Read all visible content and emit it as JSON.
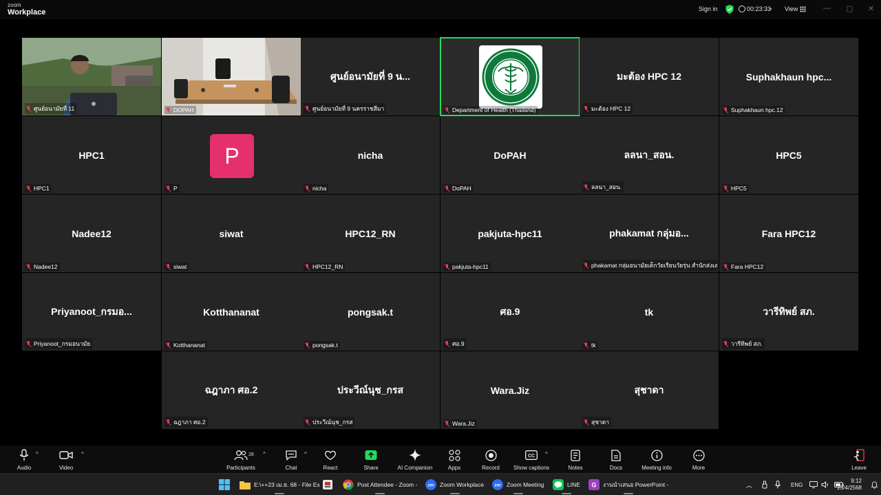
{
  "app": {
    "logo_line1": "zoom",
    "logo_line2": "Workplace",
    "sign_in": "Sign in",
    "timer": "00:23:33",
    "view": "View"
  },
  "tiles": [
    {
      "type": "video",
      "scene": "person",
      "label": "ศูนย์อนามัยที่ 11"
    },
    {
      "type": "video",
      "scene": "room",
      "label": "DOPAH"
    },
    {
      "type": "name",
      "display": "ศูนย์อนามัยที่ 9 น...",
      "label": "ศูนย์อนามัยที่ 9 นครราชสีมา"
    },
    {
      "type": "logo",
      "logo_text": "MINISTRY OF PUBLIC HEALTH",
      "label": "Department of Health (Thailand)",
      "active": true
    },
    {
      "type": "name",
      "display": "มะต้อง HPC 12",
      "label": "มะต้อง HPC 12"
    },
    {
      "type": "name",
      "display": "Suphakhaun  hpc...",
      "label": "Suphakhaun hpc.12"
    },
    {
      "type": "name",
      "display": "HPC1",
      "label": "HPC1"
    },
    {
      "type": "avatar",
      "initial": "P",
      "label": "P"
    },
    {
      "type": "name",
      "display": "nicha",
      "label": "nicha"
    },
    {
      "type": "name",
      "display": "DoPAH",
      "label": "DoPAH"
    },
    {
      "type": "name",
      "display": "ลลนา_สอน.",
      "label": "ลลนา_สอน."
    },
    {
      "type": "name",
      "display": "HPC5",
      "label": "HPC5"
    },
    {
      "type": "name",
      "display": "Nadee12",
      "label": "Nadee12"
    },
    {
      "type": "name",
      "display": "siwat",
      "label": "siwat"
    },
    {
      "type": "name",
      "display": "HPC12_RN",
      "label": "HPC12_RN"
    },
    {
      "type": "name",
      "display": "pakjuta-hpc11",
      "label": "pakjuta-hpc11"
    },
    {
      "type": "name",
      "display": "phakamat กลุ่มอ...",
      "label": "phakamat กลุ่มอนามัยเด็กวัยเรียนวัยรุ่น สำนักส่งเสริม..."
    },
    {
      "type": "name",
      "display": "Fara HPC12",
      "label": "Fara HPC12"
    },
    {
      "type": "name",
      "display": "Priyanoot_กรมอ...",
      "label": "Priyanoot_กรมอนามัย"
    },
    {
      "type": "name",
      "display": "Kotthananat",
      "label": "Kotthananat"
    },
    {
      "type": "name",
      "display": "pongsak.t",
      "label": "pongsak.t"
    },
    {
      "type": "name",
      "display": "ศอ.9",
      "label": "ศอ.9"
    },
    {
      "type": "name",
      "display": "tk",
      "label": "tk"
    },
    {
      "type": "name",
      "display": "วารีทิพย์ สภ.",
      "label": "วารีทิพย์ สภ."
    },
    {
      "type": "name",
      "display": "ฉฎาภา ศอ.2",
      "label": "ฉฎาภา ศอ.2"
    },
    {
      "type": "name",
      "display": "ประวีณ์นุช_กรส",
      "label": "ประวีณ์นุช_กรส"
    },
    {
      "type": "name",
      "display": "Wara.Jiz",
      "label": "Wara.Jiz"
    },
    {
      "type": "name",
      "display": "สุชาดา",
      "label": "สุชาดา"
    }
  ],
  "toolbar": {
    "audio": "Audio",
    "video": "Video",
    "participants": "Participants",
    "participants_count": "28",
    "chat": "Chat",
    "react": "React",
    "share": "Share",
    "ai_companion": "AI Companion",
    "apps": "Apps",
    "record": "Record",
    "captions": "Show captions",
    "notes": "Notes",
    "docs": "Docs",
    "meeting_info": "Meeting info",
    "more": "More",
    "leave": "Leave"
  },
  "taskbar": {
    "explorer": "E:\\++23 เม.ย. 68 - File Ex",
    "chrome": "Post Attendee - Zoom -",
    "zoom_workplace": "Zoom Workplace",
    "zoom_meeting": "Zoom Meeting",
    "line": "LINE",
    "powerpoint": "งานนำเสนอ PowerPoint -",
    "lang": "ENG",
    "time": "9:12",
    "date": "23/4/2568"
  },
  "colors": {
    "tile_bg": "#252525",
    "active_border": "#23d959",
    "avatar_p": "#e5306c",
    "share_green": "#23d959"
  }
}
